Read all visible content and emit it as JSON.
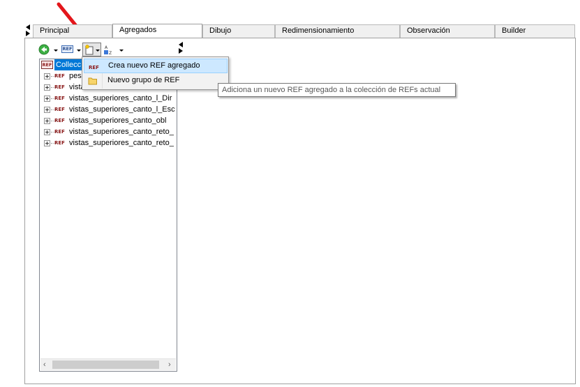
{
  "tabs": [
    {
      "label": "Principal"
    },
    {
      "label": "Agregados"
    },
    {
      "label": "Dibujo"
    },
    {
      "label": "Redimensionamiento"
    },
    {
      "label": "Observación"
    },
    {
      "label": "Builder"
    }
  ],
  "active_tab": "Agregados",
  "toolbar": {
    "back_icon": "green-back-arrow-icon",
    "ref_icon_label": "REF",
    "new_icon": "new-document-icon",
    "sort_icon": "sort-az-icon",
    "sort_icon_text": "AZ"
  },
  "tree": {
    "root": {
      "icon_label": "REF",
      "label": "Collecc"
    },
    "items": [
      {
        "icon_label": "REF",
        "label": "pes"
      },
      {
        "icon_label": "REF",
        "label": "vista"
      },
      {
        "icon_label": "REF",
        "label": "vistas_superiores_canto_l_Dir"
      },
      {
        "icon_label": "REF",
        "label": "vistas_superiores_canto_l_Esc"
      },
      {
        "icon_label": "REF",
        "label": "vistas_superiores_canto_obl"
      },
      {
        "icon_label": "REF",
        "label": "vistas_superiores_canto_reto_"
      },
      {
        "icon_label": "REF",
        "label": "vistas_superiores_canto_reto_"
      }
    ]
  },
  "menu": {
    "items": [
      {
        "label": "Crea nuevo REF agregado",
        "icon_label": "REF"
      },
      {
        "label": "Nuevo grupo de REF",
        "icon": "folder-icon"
      }
    ]
  },
  "tooltip": {
    "text": "Adiciona un nuevo REF agregado a la colección de REFs actual"
  },
  "colors": {
    "selection": "#0078d7",
    "menu_highlight": "#cde8ff",
    "annotation_arrow": "#e3161b"
  }
}
